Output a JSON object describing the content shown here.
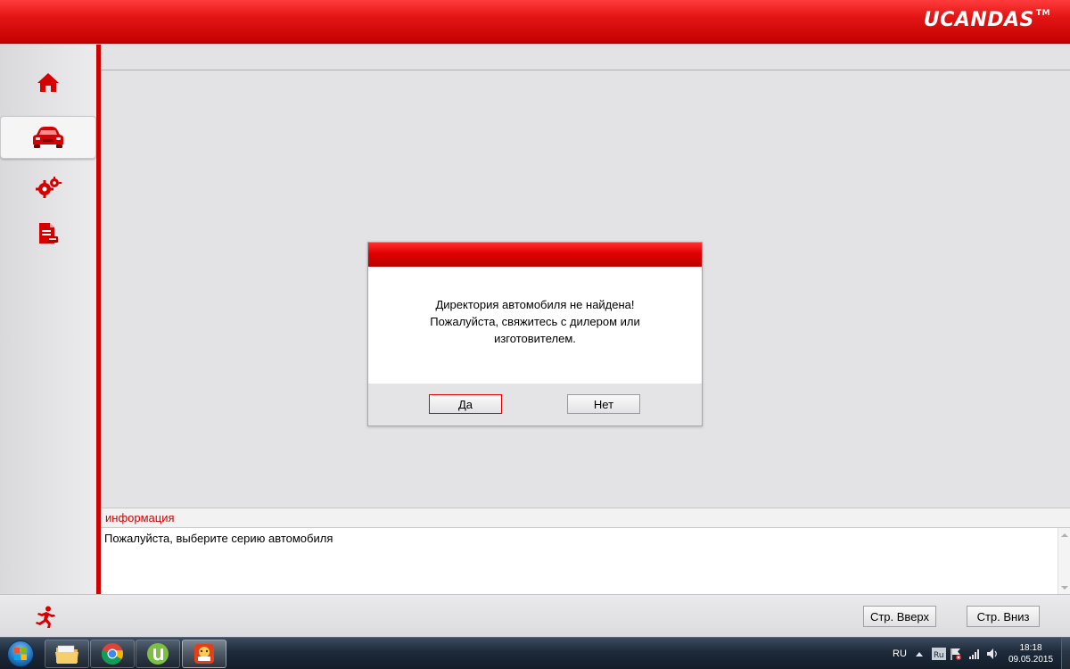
{
  "app": {
    "logo_text": "UCANDAS",
    "logo_tm": "TM"
  },
  "sidebar": {
    "items": [
      {
        "name": "home",
        "icon": "home-icon",
        "active": false
      },
      {
        "name": "vehicle",
        "icon": "car-icon",
        "active": true
      },
      {
        "name": "settings",
        "icon": "gears-icon",
        "active": false
      },
      {
        "name": "report",
        "icon": "report-icon",
        "active": false
      }
    ],
    "exit_icon": "running-man-icon"
  },
  "dialog": {
    "message_line1": "Директория автомобиля не найдена!",
    "message_line2": "Пожалуйста, свяжитесь с дилером или",
    "message_line3": "изготовителем.",
    "yes_label": "Да",
    "no_label": "Нет"
  },
  "info": {
    "title": "информация",
    "text": "Пожалуйста, выберите серию автомобиля"
  },
  "bottombar": {
    "page_up_label": "Стр. Вверх",
    "page_down_label": "Стр. Вниз"
  },
  "taskbar": {
    "apps": [
      "file-explorer-icon",
      "chrome-icon",
      "utorrent-icon",
      "ucandas-app-icon"
    ],
    "lang": "RU",
    "time": "18:18",
    "date": "09.05.2015"
  },
  "colors": {
    "brand_red": "#d00000",
    "background": "#e3e3e6"
  }
}
